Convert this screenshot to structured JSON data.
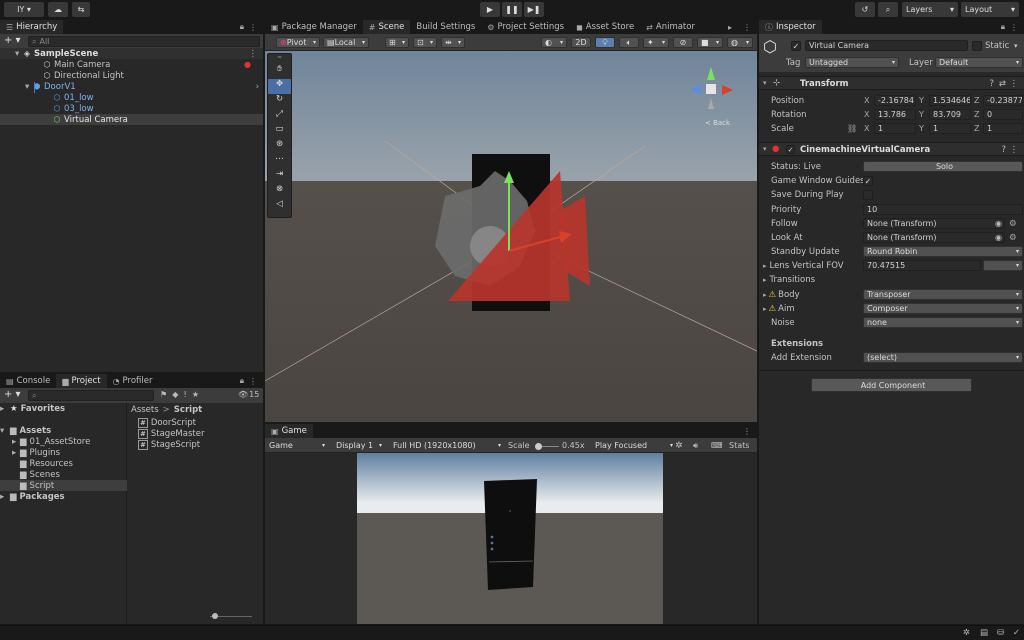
{
  "toolbar": {
    "account": "IY",
    "layers": "Layers",
    "layout": "Layout"
  },
  "tabs": {
    "hierarchy": "Hierarchy",
    "package_manager": "Package Manager",
    "scene": "Scene",
    "build_settings": "Build Settings",
    "project_settings": "Project Settings",
    "asset_store": "Asset Store",
    "animator": "Animator",
    "inspector": "Inspector",
    "console": "Console",
    "project": "Project",
    "profiler": "Profiler",
    "game": "Game"
  },
  "hierarchy": {
    "search_placeholder": "All",
    "items": [
      {
        "label": "SampleScene",
        "depth": 0
      },
      {
        "label": "Main Camera",
        "depth": 1
      },
      {
        "label": "Directional Light",
        "depth": 1
      },
      {
        "label": "DoorV1",
        "depth": 1
      },
      {
        "label": "01_low",
        "depth": 2
      },
      {
        "label": "03_low",
        "depth": 2
      },
      {
        "label": "Virtual Camera",
        "depth": 2
      }
    ]
  },
  "scene_toolbar": {
    "pivot": "Pivot",
    "local": "Local",
    "mode_2d": "2D"
  },
  "gizmo": {
    "back_label": "< Back"
  },
  "project": {
    "tree": [
      "Favorites",
      "Assets",
      "01_AssetStore",
      "Plugins",
      "Resources",
      "Scenes",
      "Script",
      "Packages"
    ],
    "breadcrumb_root": "Assets",
    "breadcrumb_sep": ">",
    "breadcrumb_leaf": "Script",
    "files": [
      "DoorScript",
      "StageMaster",
      "StageScript"
    ],
    "count": "15"
  },
  "game": {
    "mode": "Game",
    "display": "Display 1",
    "resolution": "Full HD (1920x1080)",
    "scale_label": "Scale",
    "scale_value": "0.45x",
    "play_mode": "Play Focused",
    "stats": "Stats"
  },
  "inspector": {
    "object_name": "Virtual Camera",
    "static_label": "Static",
    "tag_label": "Tag",
    "tag_value": "Untagged",
    "layer_label": "Layer",
    "layer_value": "Default",
    "transform": {
      "title": "Transform",
      "position_label": "Position",
      "rotation_label": "Rotation",
      "scale_label": "Scale",
      "position": {
        "x": "-2.16784",
        "y": "1.534646",
        "z": "-0.23877"
      },
      "rotation": {
        "x": "13.786",
        "y": "83.709",
        "z": "0"
      },
      "scale": {
        "x": "1",
        "y": "1",
        "z": "1"
      }
    },
    "vcam": {
      "title": "CinemachineVirtualCamera",
      "status_label": "Status: Live",
      "solo": "Solo",
      "game_window_guides": "Game Window Guides",
      "save_during_play": "Save During Play",
      "priority_label": "Priority",
      "priority": "10",
      "follow_label": "Follow",
      "follow": "None (Transform)",
      "look_at_label": "Look At",
      "look_at": "None (Transform)",
      "standby_label": "Standby Update",
      "standby": "Round Robin",
      "lens_label": "Lens Vertical FOV",
      "lens": "70.47515",
      "transitions_label": "Transitions",
      "body_label": "Body",
      "body": "Transposer",
      "aim_label": "Aim",
      "aim": "Composer",
      "noise_label": "Noise",
      "noise": "none",
      "extensions_label": "Extensions",
      "add_extension_label": "Add Extension",
      "add_extension": "(select)"
    },
    "add_component": "Add Component"
  },
  "colors": {
    "panel": "#282828",
    "header": "#191919",
    "accent": "#4d7fd1",
    "selection": "#3e3e3e"
  }
}
